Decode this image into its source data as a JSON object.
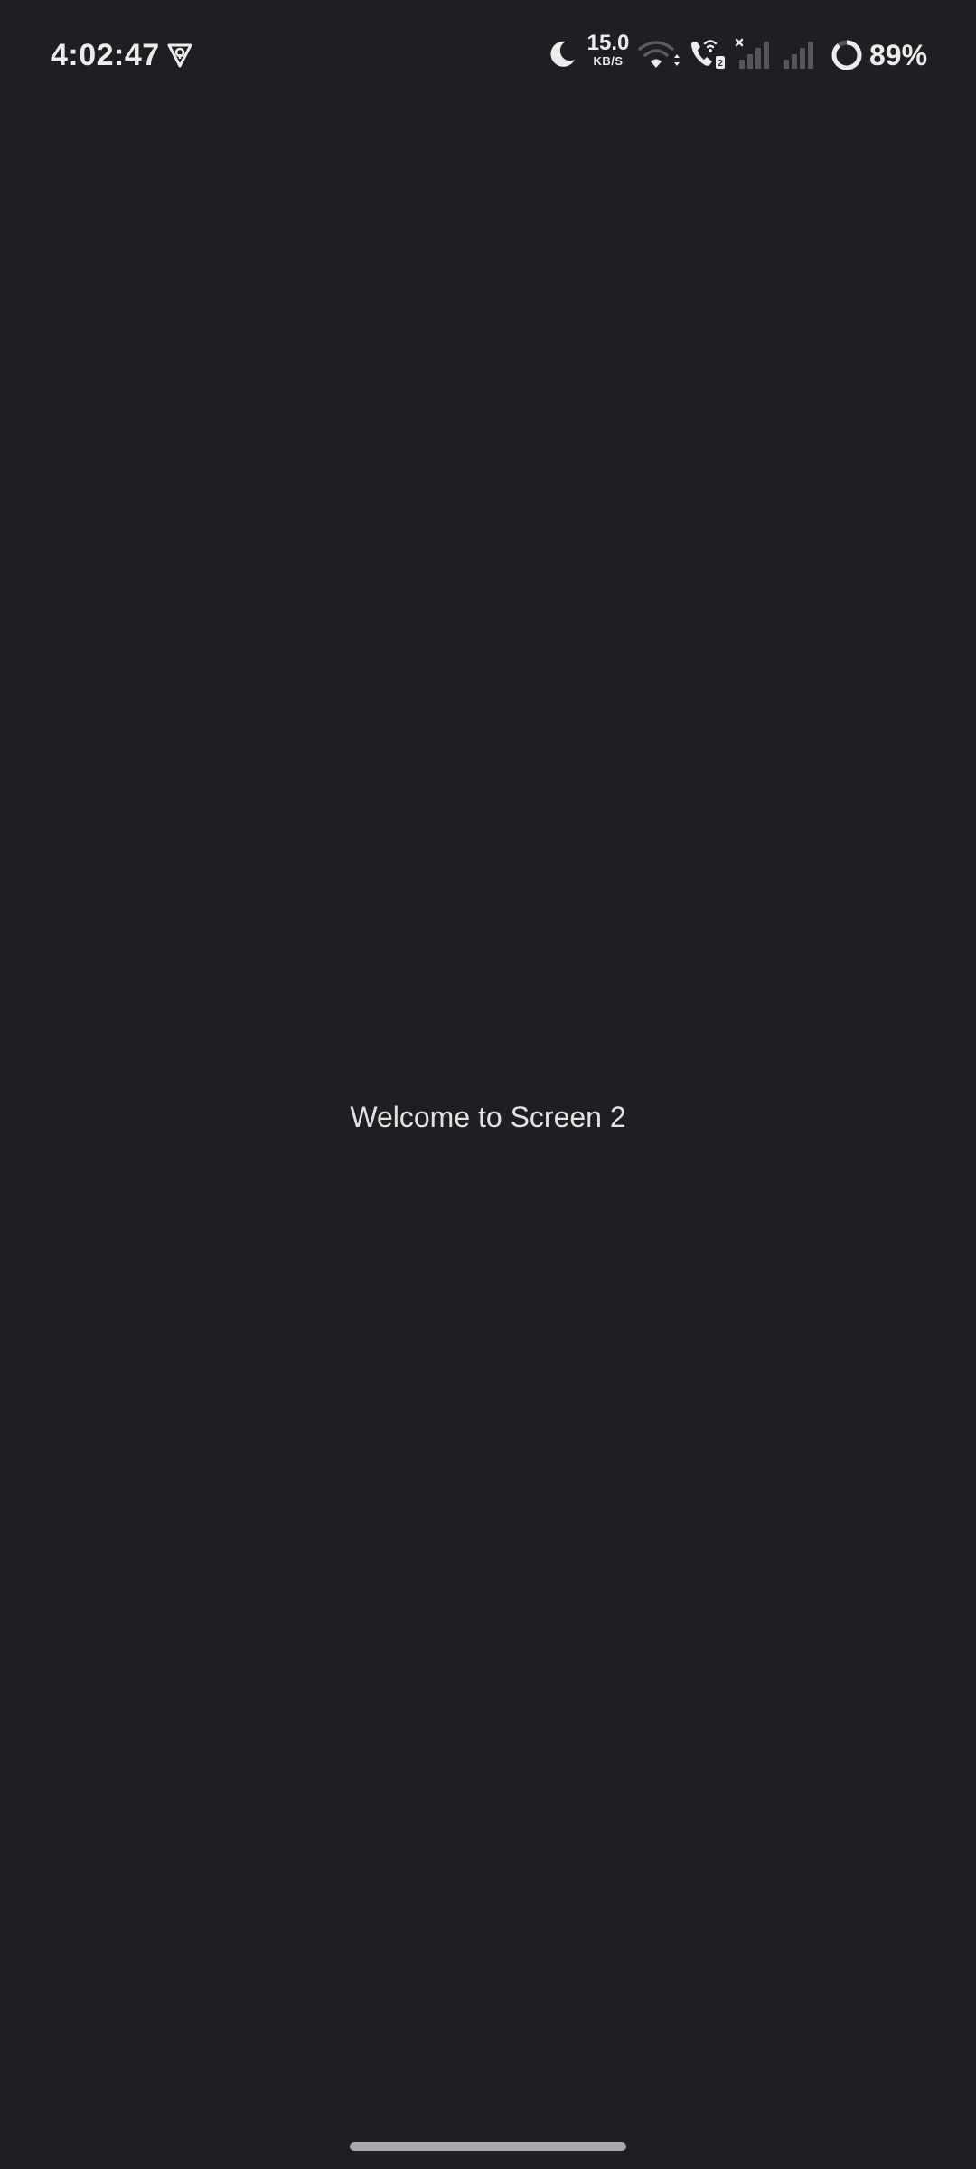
{
  "status_bar": {
    "time": "4:02:47",
    "net_speed_value": "15.0",
    "net_speed_unit": "KB/S",
    "battery_percent": "89%",
    "icons": [
      "vpn-icon",
      "moon-icon",
      "wifi-icon",
      "volte-call-icon",
      "signal-sim1-icon",
      "signal-sim2-icon",
      "battery-ring-icon"
    ]
  },
  "main": {
    "welcome_text": "Welcome to Screen 2"
  },
  "colors": {
    "background": "#1f1e22",
    "text": "#e2e2e2",
    "icon_dim": "#55555a",
    "home_indicator": "#a9a9ad"
  }
}
